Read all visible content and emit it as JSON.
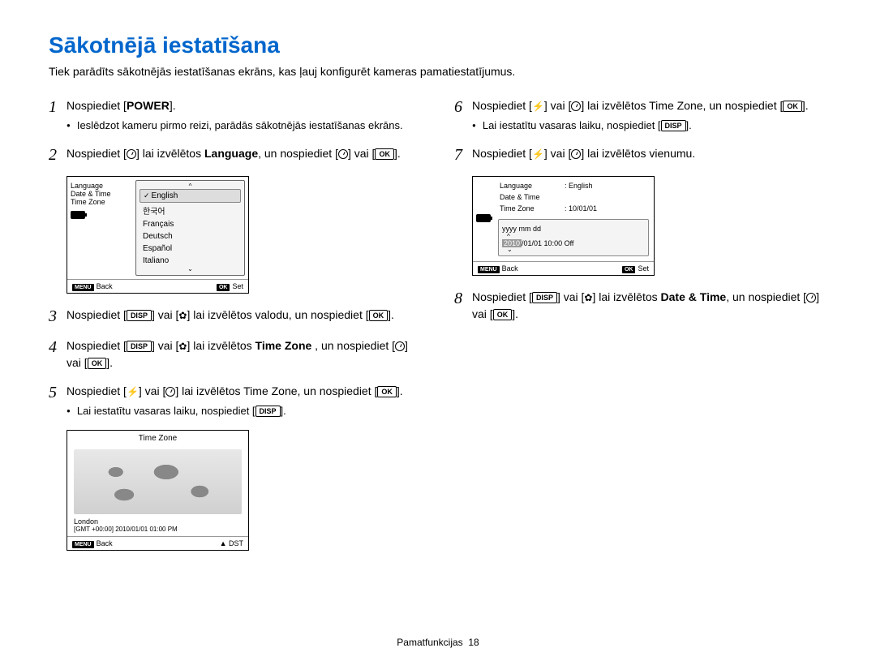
{
  "title": "Sākotnējā iestatīšana",
  "intro": "Tiek parādīts sākotnējās iestatīšanas ekrāns, kas ļauj konfigurēt kameras pamatiestatījumus.",
  "steps": {
    "s1": {
      "num": "1",
      "prefix": "Nospiediet [",
      "power": "POWER",
      "suffix": "].",
      "bullet": "Ieslēdzot kameru pirmo reizi, parādās sākotnējās iestatīšanas ekrāns."
    },
    "s2": {
      "num": "2",
      "a": "Nospiediet [",
      "b": "] lai izvēlētos ",
      "lang": "Language",
      "c": ", un nospiediet [",
      "d": "] vai [",
      "ok": "OK",
      "e": "]."
    },
    "s3": {
      "num": "3",
      "a": "Nospiediet [",
      "disp": "DISP",
      "b": "] vai [",
      "c": "] lai izvēlētos valodu, un nospiediet [",
      "ok": "OK",
      "d": "]."
    },
    "s4": {
      "num": "4",
      "a": "Nospiediet [",
      "disp": "DISP",
      "b": "] vai [",
      "c": "] lai izvēlētos ",
      "tz": "Time Zone",
      "d": " , un nospiediet [",
      "e": "] vai [",
      "ok": "OK",
      "f": "]."
    },
    "s5": {
      "num": "5",
      "a": "Nospiediet [",
      "b": "] vai [",
      "c": "] lai izvēlētos Time Zone, un nospiediet [",
      "ok": "OK",
      "d": "].",
      "bullet_a": "Lai iestatītu vasaras laiku, nospiediet [",
      "disp": "DISP",
      "bullet_b": "]."
    },
    "s6": {
      "num": "6",
      "a": "Nospiediet [",
      "b": "] vai [",
      "c": "] lai izvēlētos Time Zone, un nospiediet [",
      "ok": "OK",
      "d": "].",
      "bullet_a": "Lai iestatītu vasaras laiku, nospiediet [",
      "disp": "DISP",
      "bullet_b": "]."
    },
    "s7": {
      "num": "7",
      "a": "Nospiediet [",
      "b": "] vai [",
      "c": "] lai izvēlētos vienumu."
    },
    "s8": {
      "num": "8",
      "a": "Nospiediet [",
      "disp": "DISP",
      "b": "] vai [",
      "c": "] lai izvēlētos ",
      "dt": "Date & Time",
      "d": ", un nospiediet [",
      "e": "] vai [",
      "ok": "OK",
      "f": "]."
    }
  },
  "panel_lang": {
    "left": [
      "Language",
      "Date & Time",
      "Time Zone"
    ],
    "items": [
      "English",
      "한국어",
      "Français",
      "Deutsch",
      "Español",
      "Italiano"
    ],
    "foot_back": "Back",
    "foot_set": "Set",
    "menu": "MENU",
    "ok": "OK"
  },
  "panel_tz": {
    "title": "Time Zone",
    "loc": "London",
    "gmt": "[GMT +00:00] 2010/01/01 01:00 PM",
    "foot_back": "Back",
    "foot_dst": "DST",
    "menu": "MENU"
  },
  "panel_date": {
    "rows": [
      {
        "k": "Language",
        "v": ": English"
      },
      {
        "k": "Date & Time",
        "v": ""
      },
      {
        "k": "Time Zone",
        "v": ": 10/01/01"
      }
    ],
    "fmt": "yyyy   mm   dd",
    "value_pre": "2010",
    "value_post": "/01/01   10:00           Off",
    "foot_back": "Back",
    "foot_set": "Set",
    "menu": "MENU",
    "ok": "OK"
  },
  "footer": {
    "label": "Pamatfunkcijas",
    "page": "18"
  }
}
